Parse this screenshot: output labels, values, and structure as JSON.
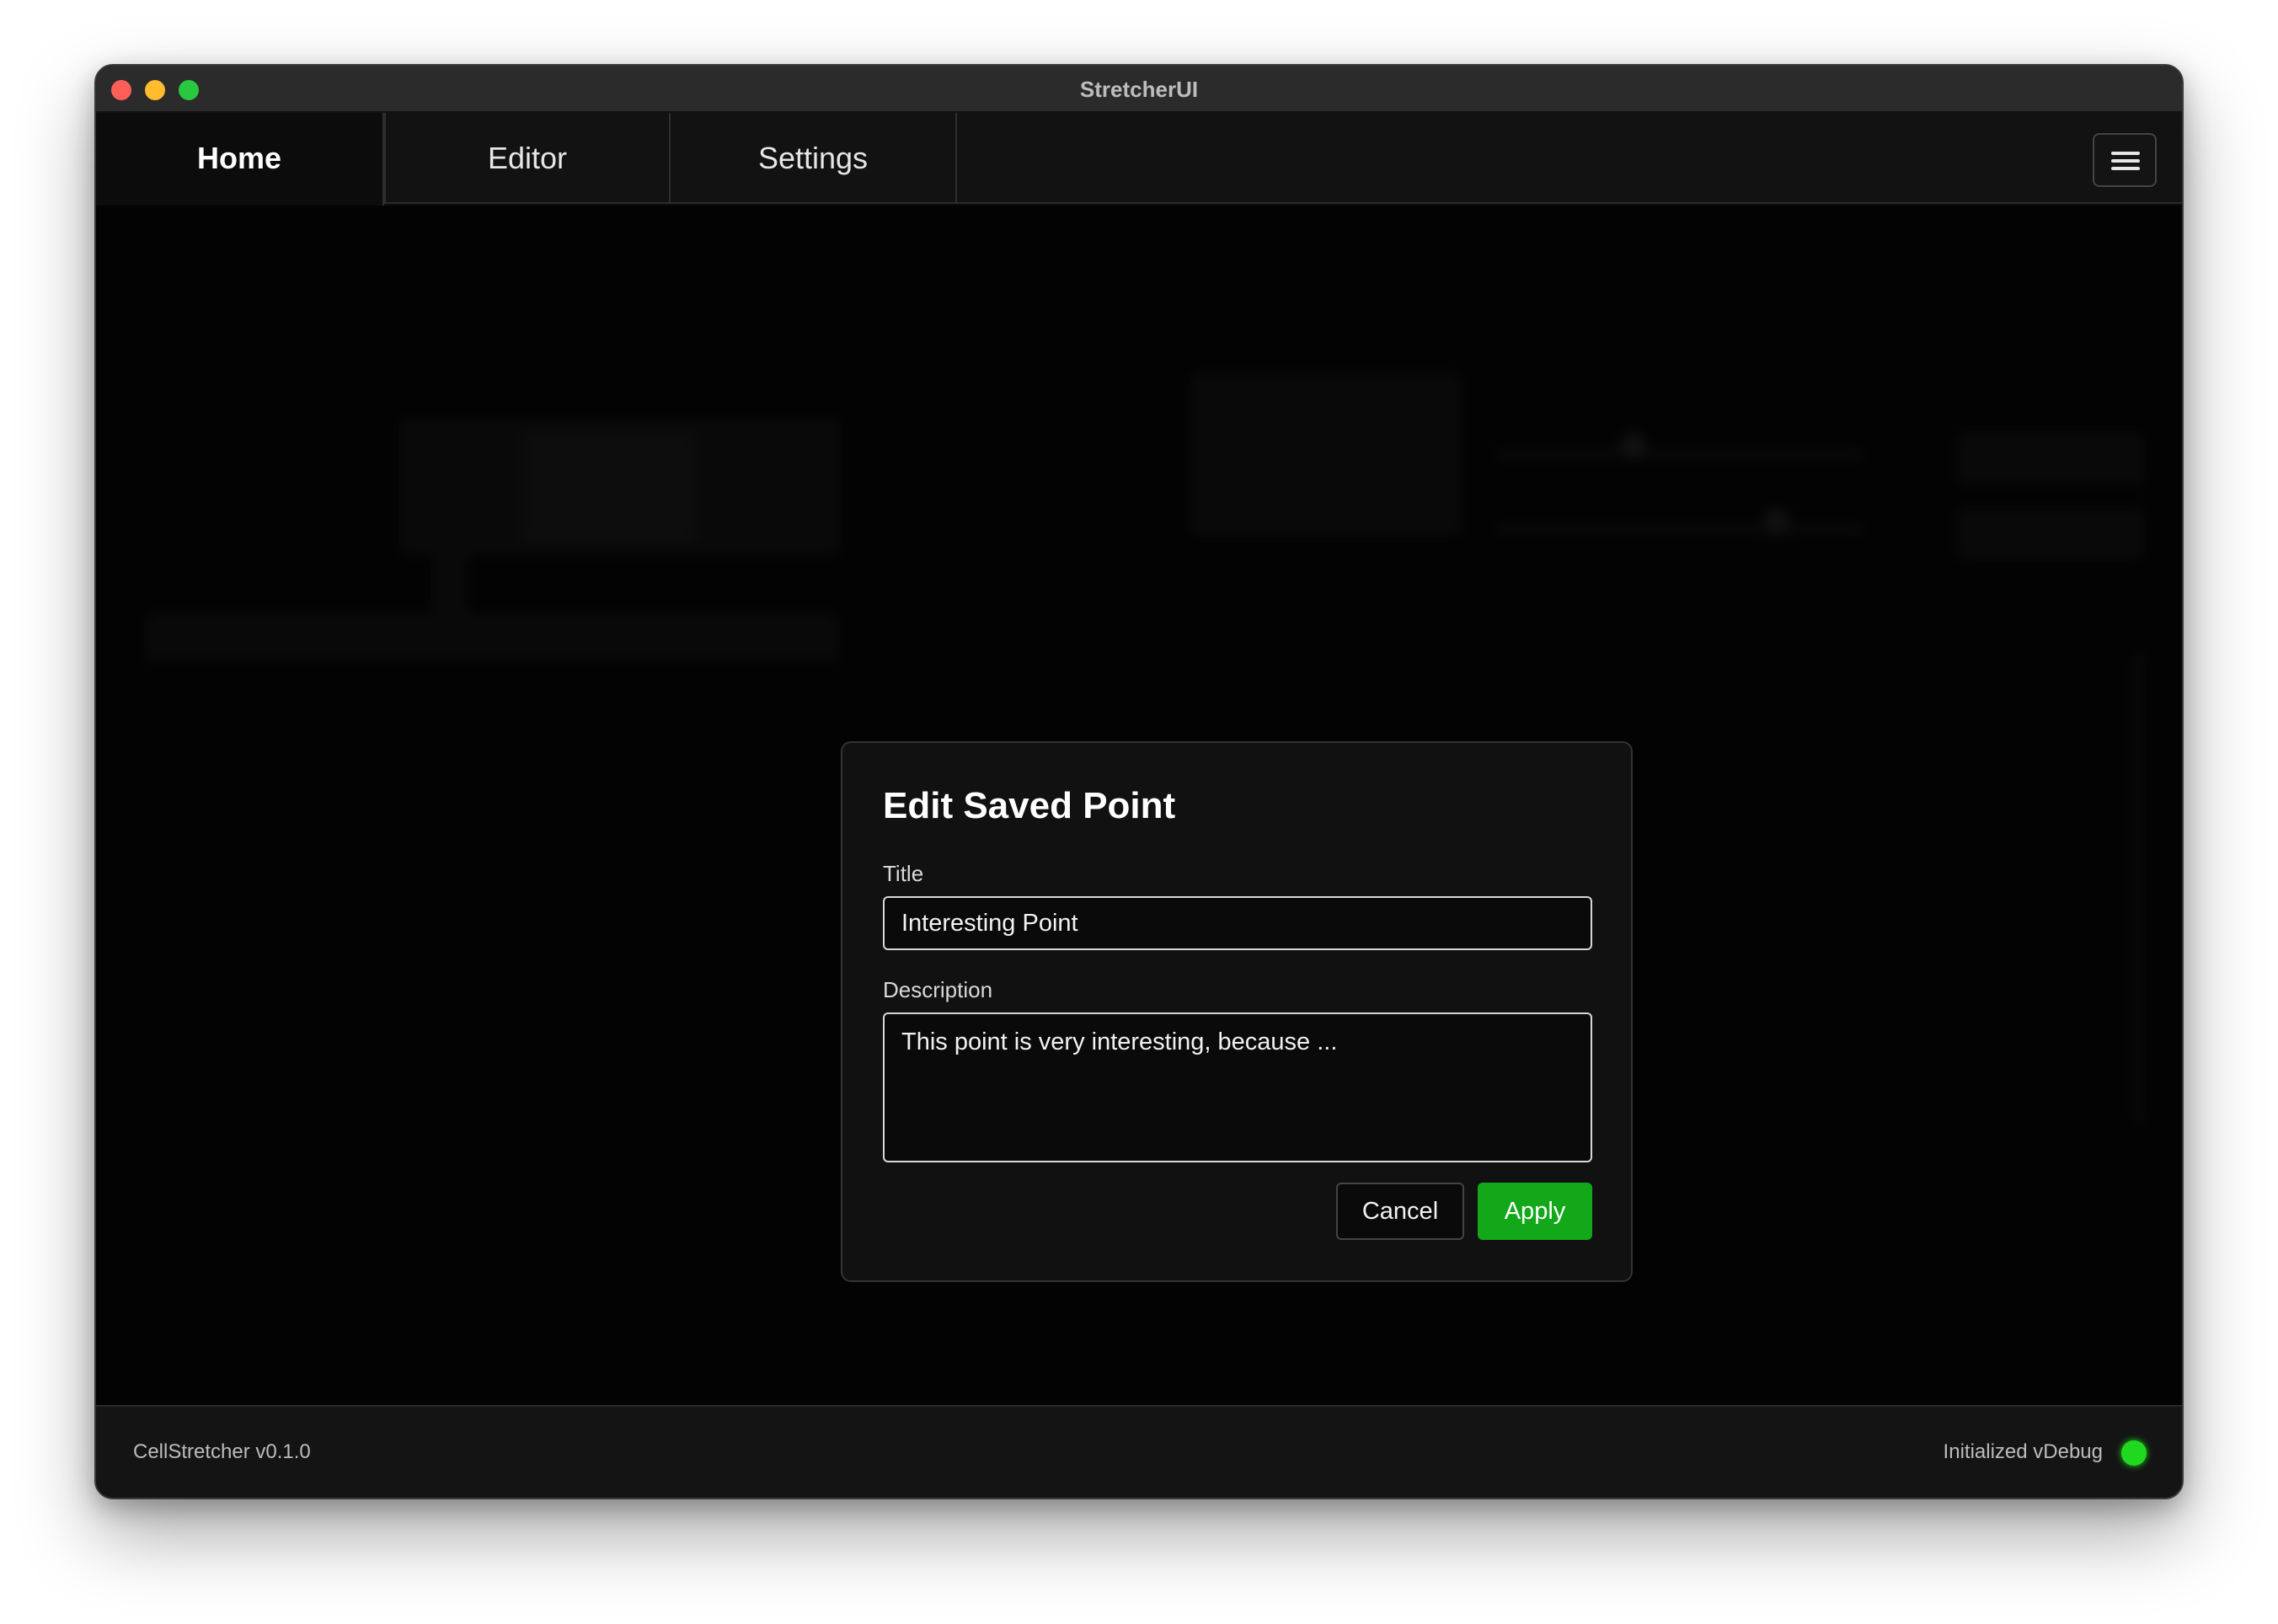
{
  "window": {
    "title": "StretcherUI"
  },
  "tabs": [
    {
      "label": "Home",
      "active": true
    },
    {
      "label": "Editor",
      "active": false
    },
    {
      "label": "Settings",
      "active": false
    }
  ],
  "menu": {
    "icon": "hamburger-menu-icon"
  },
  "dialog": {
    "title": "Edit Saved Point",
    "title_label": "Title",
    "title_value": "Interesting Point",
    "description_label": "Description",
    "description_value": "This point is very interesting, because ...",
    "cancel_label": "Cancel",
    "apply_label": "Apply"
  },
  "footer": {
    "version": "CellStretcher v0.1.0",
    "status": "Initialized vDebug",
    "status_color": "#1fd81f"
  },
  "colors": {
    "accent": "#12a81a",
    "background": "#070707"
  }
}
